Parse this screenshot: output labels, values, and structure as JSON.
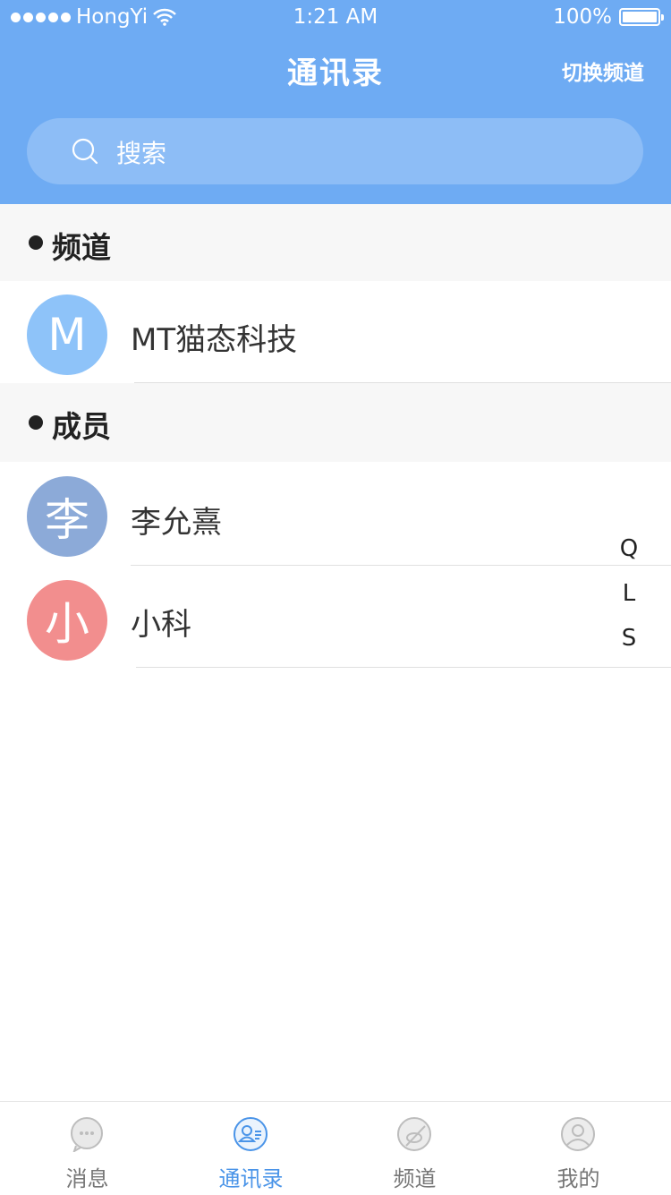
{
  "status_bar": {
    "carrier": "HongYi",
    "time": "1:21 AM",
    "battery": "100%"
  },
  "nav": {
    "title": "通讯录",
    "right_action": "切换频道"
  },
  "search": {
    "placeholder": "搜索"
  },
  "sections": [
    {
      "title": "频道",
      "items": [
        {
          "avatar_text": "M",
          "avatar_color": "#8ec3f9",
          "name": "MT猫态科技"
        }
      ]
    },
    {
      "title": "成员",
      "items": [
        {
          "avatar_text": "李",
          "avatar_color": "#8caad8",
          "name": "李允熹"
        },
        {
          "avatar_text": "小",
          "avatar_color": "#f28e8e",
          "name": "小科"
        }
      ]
    }
  ],
  "index_bar": [
    "Q",
    "L",
    "S"
  ],
  "tabs": [
    {
      "label": "消息",
      "icon": "message-icon",
      "active": false
    },
    {
      "label": "通讯录",
      "icon": "contacts-icon",
      "active": true
    },
    {
      "label": "频道",
      "icon": "channel-icon",
      "active": false
    },
    {
      "label": "我的",
      "icon": "profile-icon",
      "active": false
    }
  ],
  "colors": {
    "header": "#6eabf3",
    "accent": "#4a94e8",
    "section_bg": "#f7f7f7"
  }
}
